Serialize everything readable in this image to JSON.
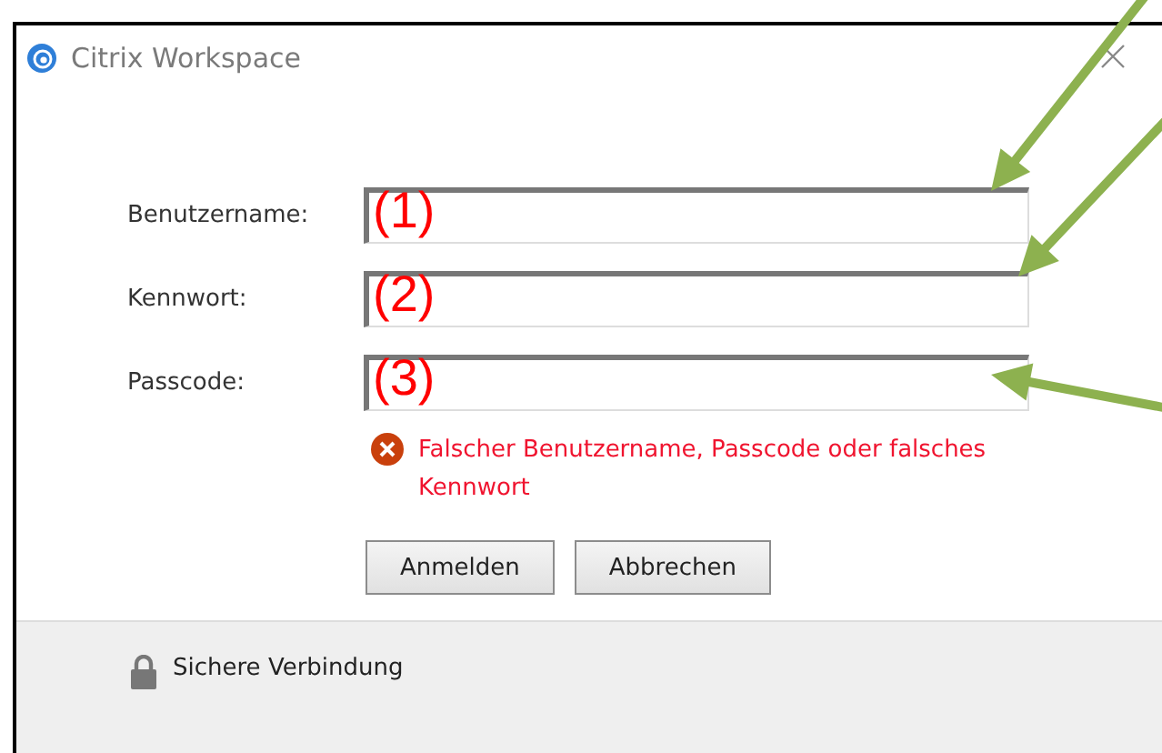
{
  "window": {
    "title": "Citrix Workspace"
  },
  "fields": [
    {
      "label": "Benutzername:",
      "annotation": "(1)"
    },
    {
      "label": "Kennwort:",
      "annotation": "(2)"
    },
    {
      "label": "Passcode:",
      "annotation": "(3)"
    }
  ],
  "error": {
    "message": "Falscher Benutzername, Passcode oder falsches Kennwort"
  },
  "buttons": [
    "Anmelden",
    "Abbrechen"
  ],
  "status_bar": {
    "text": "Sichere Verbindung"
  }
}
